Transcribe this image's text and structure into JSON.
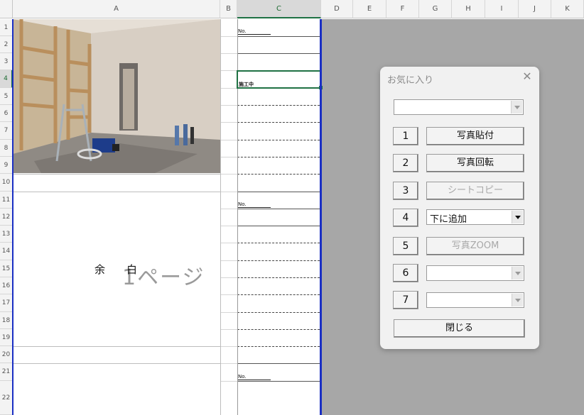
{
  "sheet": {
    "columns": [
      "A",
      "B",
      "C",
      "D",
      "E",
      "F",
      "G",
      "H",
      "I",
      "J",
      "K"
    ],
    "rows": [
      "1",
      "2",
      "3",
      "4",
      "5",
      "6",
      "7",
      "8",
      "9",
      "10",
      "11",
      "12",
      "13",
      "14",
      "15",
      "16",
      "17",
      "18",
      "19",
      "20",
      "21",
      "22"
    ],
    "cells": {
      "no_label": "No.",
      "status_text": "施工中",
      "margin_left": "余",
      "margin_right": "白",
      "page_watermark": "1ページ"
    }
  },
  "dialog": {
    "title": "お気に入り",
    "top_dropdown_value": "",
    "rows": [
      {
        "num": "1",
        "label": "写真貼付",
        "type": "button",
        "enabled": true
      },
      {
        "num": "2",
        "label": "写真回転",
        "type": "button",
        "enabled": true
      },
      {
        "num": "3",
        "label": "シートコピー",
        "type": "button",
        "enabled": false
      },
      {
        "num": "4",
        "label": "下に追加",
        "type": "dropdown",
        "enabled": true
      },
      {
        "num": "5",
        "label": "写真ZOOM",
        "type": "button",
        "enabled": false
      },
      {
        "num": "6",
        "label": "",
        "type": "dropdown",
        "enabled": false
      },
      {
        "num": "7",
        "label": "",
        "type": "dropdown",
        "enabled": false
      }
    ],
    "close_label": "閉じる"
  },
  "colors": {
    "selection_green": "#1f7244",
    "page_break_blue": "#1a2fc4",
    "background_grey": "#a7a7a7"
  }
}
